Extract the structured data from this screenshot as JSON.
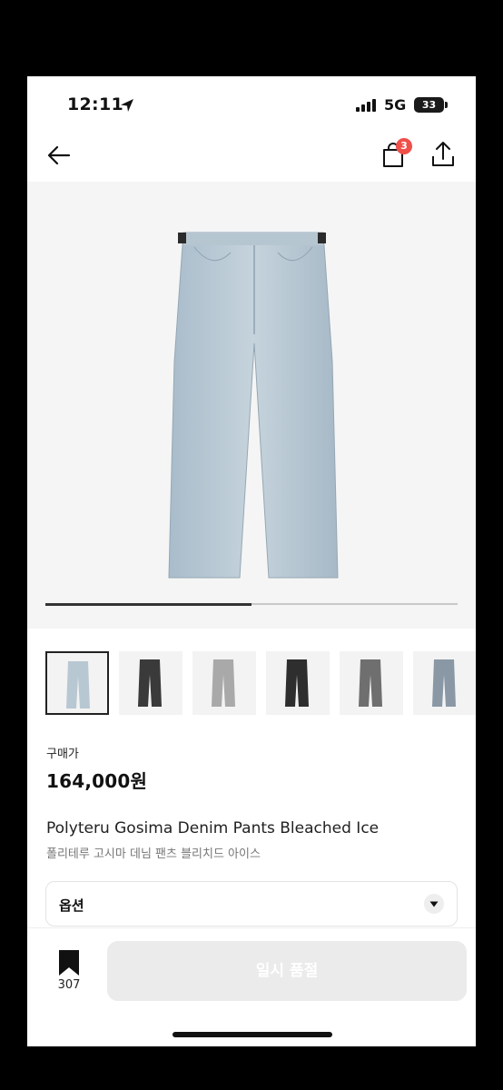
{
  "status_bar": {
    "time": "12:11",
    "network": "5G",
    "battery": "33",
    "icons": [
      "location-arrow-icon",
      "signal-bars-icon",
      "battery-icon"
    ]
  },
  "nav": {
    "icons": [
      "back-arrow-icon",
      "shopping-bag-icon",
      "share-icon"
    ],
    "cart_count": "3"
  },
  "gallery": {
    "progress_fraction": 0.5,
    "thumbnails": [
      {
        "color": "#b8c8d2",
        "selected": true
      },
      {
        "color": "#3a3a3a",
        "selected": false
      },
      {
        "color": "#a9a9a9",
        "selected": false
      },
      {
        "color": "#2e2e2e",
        "selected": false
      },
      {
        "color": "#6f6f6f",
        "selected": false
      },
      {
        "color": "#8a98a6",
        "selected": false
      }
    ]
  },
  "product": {
    "price_label": "구매가",
    "price": "164,000원",
    "title_en": "Polyteru Gosima Denim Pants Bleached Ice",
    "title_ko": "폴리테루 고시마 데님 팬츠 블리치드 아이스"
  },
  "option": {
    "label": "옵션"
  },
  "bottom_bar": {
    "bookmark_count": "307",
    "action_label": "일시 품절"
  },
  "colors": {
    "badge": "#f0504a",
    "disabled_button": "#ebebeb"
  }
}
